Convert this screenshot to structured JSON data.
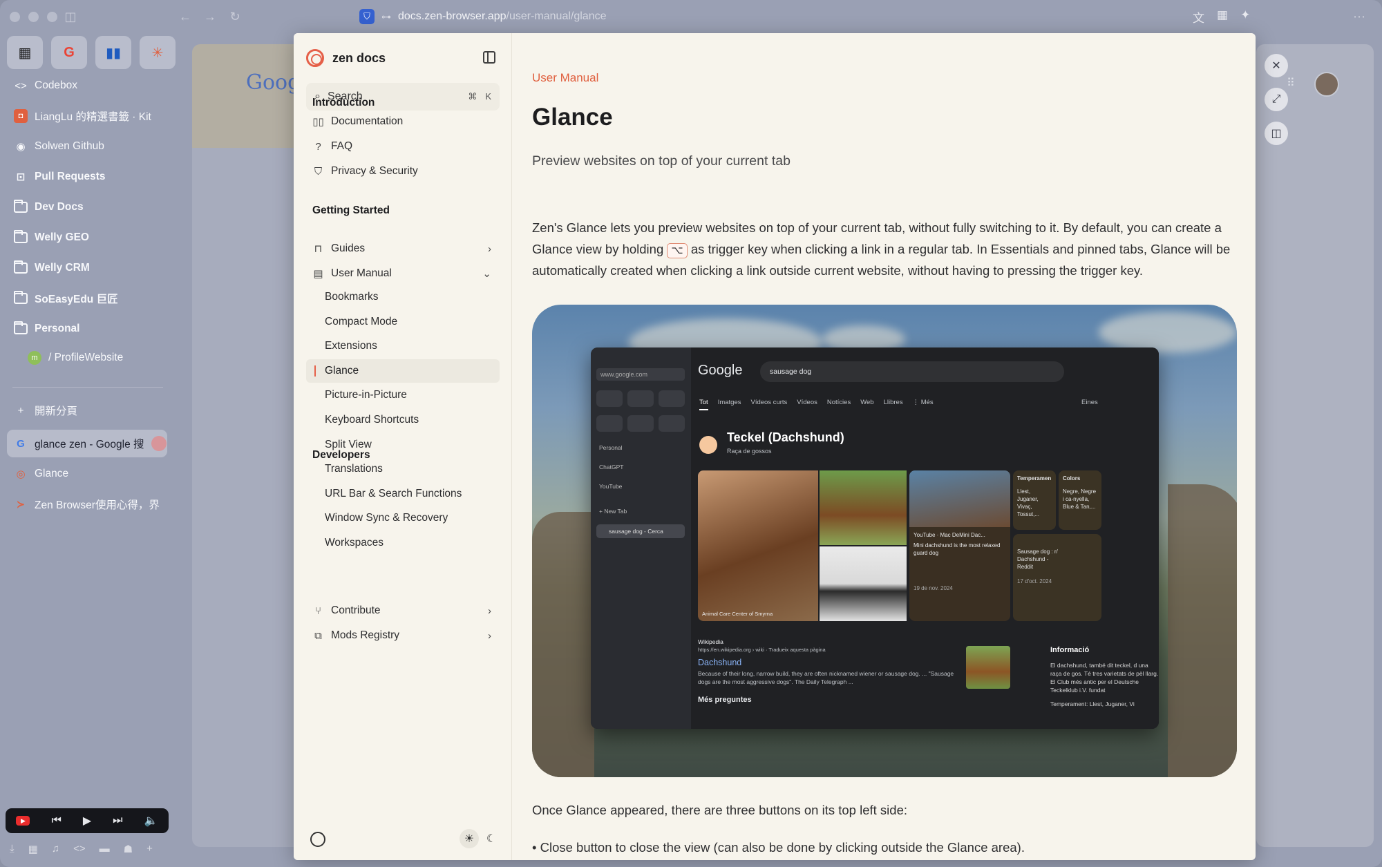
{
  "browser": {
    "url_host": "docs.zen-browser.app",
    "url_path": "/user-manual/glance"
  },
  "sidebar": {
    "essentials": [
      {
        "icon": "calendar-icon",
        "glyph": "▦"
      },
      {
        "icon": "google-icon",
        "glyph": "G"
      },
      {
        "icon": "trello-icon",
        "glyph": "▮▮"
      },
      {
        "icon": "claude-icon",
        "glyph": "✳"
      }
    ],
    "items": [
      {
        "label": "Codebox",
        "icon": "code-icon",
        "glyph": "<>",
        "bold": false
      },
      {
        "label": "LiangLu 的精選書籤 · Kit",
        "icon": "kit-icon",
        "glyph": "◘",
        "bold": false
      },
      {
        "label": "Solwen Github",
        "icon": "github-icon",
        "glyph": "◉",
        "bold": false
      },
      {
        "label": "Pull Requests",
        "icon": "pull-request-icon",
        "glyph": "⊡",
        "bold": true
      },
      {
        "label": "Dev Docs",
        "icon": "folder-icon",
        "glyph": "",
        "bold": true
      },
      {
        "label": "Welly GEO",
        "icon": "folder-icon",
        "glyph": "",
        "bold": true
      },
      {
        "label": "Welly CRM",
        "icon": "folder-icon",
        "glyph": "",
        "bold": true
      },
      {
        "label": "SoEasyEdu 巨匠",
        "icon": "folder-icon",
        "glyph": "",
        "bold": true
      },
      {
        "label": "Personal",
        "icon": "folder-open-icon",
        "glyph": "",
        "bold": true
      },
      {
        "label": "/ ProfileWebsite",
        "icon": "profile-site-icon",
        "glyph": "m",
        "bold": false
      }
    ],
    "new_tab_label": "開新分頁",
    "tabs": [
      {
        "label": "glance zen - Google 搜",
        "icon": "google-icon",
        "glyph": "G",
        "active": true
      },
      {
        "label": "Glance",
        "icon": "zen-icon",
        "glyph": "◎",
        "active": false
      },
      {
        "label": "Zen Browser使用心得，界",
        "icon": "zen-blog-icon",
        "glyph": "≻",
        "active": false
      }
    ]
  },
  "background_page": {
    "google_peek": "Goog"
  },
  "docs": {
    "brand": "zen docs",
    "search_placeholder": "Search",
    "search_kbd_1": "⌘",
    "search_kbd_2": "K",
    "sections": [
      {
        "heading": "Introduction",
        "items": [
          {
            "label": "Documentation",
            "icon": "book-icon",
            "glyph": "▯▯"
          },
          {
            "label": "FAQ",
            "icon": "question-icon",
            "glyph": "?"
          },
          {
            "label": "Privacy & Security",
            "icon": "shield-icon",
            "glyph": "⛉"
          }
        ]
      },
      {
        "heading": "Getting Started",
        "items": [
          {
            "label": "Guides",
            "icon": "bookmark-icon",
            "glyph": "⊓",
            "chevron": "›"
          },
          {
            "label": "User Manual",
            "icon": "manual-icon",
            "glyph": "▤",
            "chevron": "⌄"
          }
        ],
        "sub_items": [
          "Bookmarks",
          "Compact Mode",
          "Extensions",
          "Glance",
          "Picture-in-Picture",
          "Keyboard Shortcuts",
          "Split View",
          "Translations",
          "URL Bar & Search Functions",
          "Window Sync & Recovery",
          "Workspaces"
        ],
        "active_sub": "Glance"
      },
      {
        "heading": "Developers",
        "items": [
          {
            "label": "Contribute",
            "icon": "git-branch-icon",
            "glyph": "⑂",
            "chevron": "›"
          },
          {
            "label": "Mods Registry",
            "icon": "puzzle-icon",
            "glyph": "⧉",
            "chevron": "›"
          }
        ]
      }
    ],
    "content": {
      "breadcrumb": "User Manual",
      "title": "Glance",
      "subtitle": "Preview websites on top of your current tab",
      "para_part1": "Zen's Glance lets you preview websites on top of your current tab, without fully switching to it. By default, you can create a Glance view by holding ",
      "trigger_key": "⌥",
      "para_part2": " as trigger key when clicking a link in a regular tab. In Essentials and pinned tabs, Glance will be automatically created when clicking a link outside current website, without having to pressing the trigger key.",
      "para2": "Once Glance appeared, there are three buttons on its top left side:",
      "bullet1": "• Close button to close the view (can also be done by clicking outside the Glance area)."
    },
    "hero_mock": {
      "url": "www.google.com",
      "side_items": [
        "Personal",
        "ChatGPT",
        "YouTube"
      ],
      "new_tab": "+ New Tab",
      "active_tab": "sausage dog - Cerca",
      "google": "Google",
      "query": "sausage dog",
      "tabs": [
        "Tot",
        "Imatges",
        "Vídeos curts",
        "Vídeos",
        "Notícies",
        "Web",
        "Llibres",
        "⋮ Més"
      ],
      "tools": "Eines",
      "kp_title": "Teckel (Dachshund)",
      "kp_sub": "Raça de gossos",
      "img_caption": "Animal Care Center of Smyrna",
      "yt_source": "YouTube · Mac DeMini Dac...",
      "yt_text": "Mini dachshund is the most relaxed guard dog",
      "yt_date": "19 de nov. 2024",
      "card1_title": "Temperamen",
      "card1_text": "Llest, Juganer, Vivaç, Tossut,...",
      "card2_title": "Colors",
      "card2_text": "Negre, Negre i ca-nyella, Blue & Tan,...",
      "reddit_text": "Sausage dog : r/ Dachshund - Reddit",
      "reddit_date": "17 d'oct. 2024",
      "wiki_source": "Wikipedia",
      "wiki_url": "https://en.wikipedia.org › wiki · Tradueix aquesta pàgina",
      "wiki_link": "Dachshund",
      "wiki_text": "Because of their long, narrow build, they are often nicknamed wiener or sausage dog. ... \"Sausage dogs are the most aggressive dogs\". The Daily Telegraph ...",
      "info_title": "Informació",
      "info_text": "El dachshund, també dit teckel, d una raça de gos. Té tres varietats de pèl llarg. El Club més antic per el Deutsche Teckelklub i.V. fundat",
      "info_temp": "Temperament: Llest, Juganer, Vi",
      "more_q": "Més preguntes"
    }
  }
}
